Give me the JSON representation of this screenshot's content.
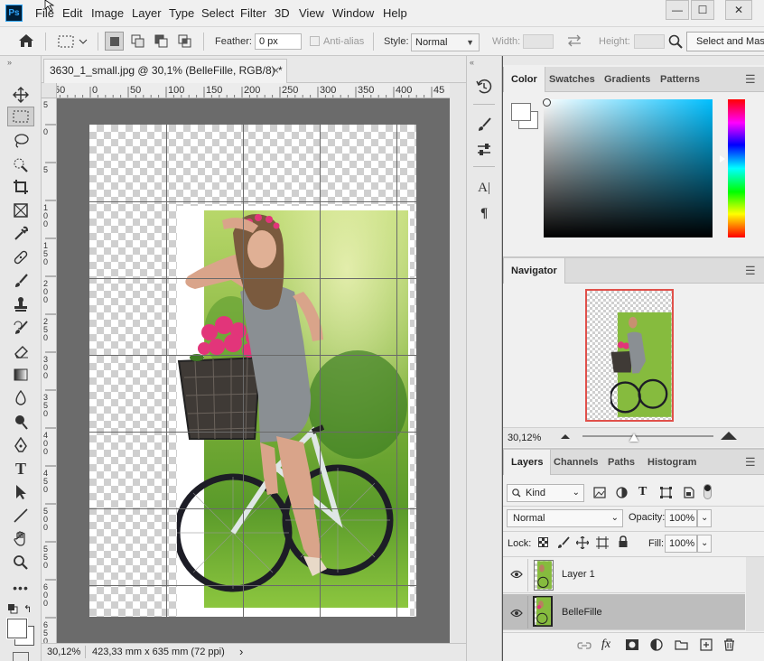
{
  "app": {
    "logo": "Ps"
  },
  "menu": [
    "File",
    "Edit",
    "Image",
    "Layer",
    "Type",
    "Select",
    "Filter",
    "3D",
    "View",
    "Window",
    "Help"
  ],
  "window_controls": {
    "minimize": "—",
    "restore": "☐",
    "close": "✕"
  },
  "options": {
    "feather_label": "Feather:",
    "feather_value": "0 px",
    "antialias_label": "Anti-alias",
    "style_label": "Style:",
    "style_value": "Normal",
    "width_label": "Width:",
    "height_label": "Height:",
    "select_mask_label": "Select and Mask..."
  },
  "document": {
    "tab_title": "3630_1_small.jpg @ 30,1% (BelleFille, RGB/8) *",
    "close_glyph": "×",
    "zoom": "30,12%",
    "doc_size": "423,33 mm x 635 mm (72 ppi)",
    "status_arrow": "›"
  },
  "ruler_top_labels": [
    "50",
    "0",
    "50",
    "100",
    "150",
    "200",
    "250",
    "300",
    "350",
    "400",
    "45"
  ],
  "ruler_left_labels": [
    "5",
    "0",
    "5",
    "1 0 0",
    "1 5 0",
    "2 0 0",
    "2 5 0",
    "3 0 0",
    "3 5 0",
    "4 0 0",
    "4 5 0",
    "5 0 0",
    "5 5 0",
    "6 0 0",
    "6 5 0"
  ],
  "color_panel": {
    "tabs": [
      "Color",
      "Swatches",
      "Gradients",
      "Patterns"
    ],
    "active": "Color"
  },
  "navigator": {
    "title": "Navigator",
    "zoom": "30,12%"
  },
  "layers_panel": {
    "tabs": [
      "Layers",
      "Channels",
      "Paths",
      "Histogram"
    ],
    "filter_kind": "Kind",
    "blend_mode": "Normal",
    "opacity_label": "Opacity:",
    "opacity_value": "100%",
    "lock_label": "Lock:",
    "fill_label": "Fill:",
    "fill_value": "100%",
    "layers": [
      {
        "name": "Layer 1",
        "visible": true,
        "selected": false
      },
      {
        "name": "BelleFille",
        "visible": true,
        "selected": true
      }
    ]
  },
  "colors": {
    "accent": "#31a8ff",
    "nav_frame": "#e0504a",
    "bg_dark": "#535353"
  }
}
